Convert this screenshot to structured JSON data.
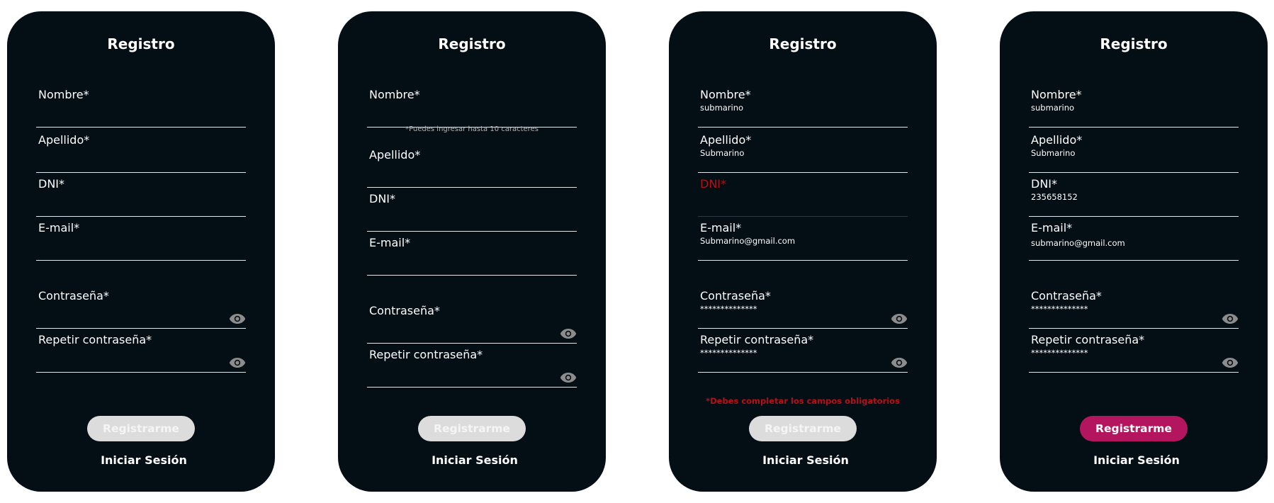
{
  "screens": [
    {
      "title": "Registro",
      "fields": {
        "nombre": {
          "label": "Nombre*",
          "value": ""
        },
        "apellido": {
          "label": "Apellido*",
          "value": ""
        },
        "dni": {
          "label": "DNI*",
          "value": ""
        },
        "email": {
          "label": "E-mail*",
          "value": ""
        },
        "password": {
          "label": "Contraseña*",
          "value": ""
        },
        "repeat_password": {
          "label": "Repetir contraseña*",
          "value": ""
        }
      },
      "submit_label": "Registrarme",
      "login_link": "Iniciar Sesión"
    },
    {
      "title": "Registro",
      "fields": {
        "nombre": {
          "label": "Nombre*",
          "value": "",
          "hint": "*Puedes ingresar hasta 10 caracteres"
        },
        "apellido": {
          "label": "Apellido*",
          "value": ""
        },
        "dni": {
          "label": "DNI*",
          "value": ""
        },
        "email": {
          "label": "E-mail*",
          "value": ""
        },
        "password": {
          "label": "Contraseña*",
          "value": ""
        },
        "repeat_password": {
          "label": "Repetir contraseña*",
          "value": ""
        }
      },
      "submit_label": "Registrarme",
      "login_link": "Iniciar Sesión"
    },
    {
      "title": "Registro",
      "fields": {
        "nombre": {
          "label": "Nombre*",
          "value": "submarino"
        },
        "apellido": {
          "label": "Apellido*",
          "value": "Submarino"
        },
        "dni": {
          "label": "DNI*",
          "value": "",
          "state": "error"
        },
        "email": {
          "label": "E-mail*",
          "value": "Submarino@gmail.com"
        },
        "password": {
          "label": "Contraseña*",
          "value": "**************"
        },
        "repeat_password": {
          "label": "Repetir contraseña*",
          "value": "**************"
        }
      },
      "error_message": "*Debes completar los campos obligatorios",
      "submit_label": "Registrarme",
      "login_link": "Iniciar Sesión"
    },
    {
      "title": "Registro",
      "fields": {
        "nombre": {
          "label": "Nombre*",
          "value": "submarino"
        },
        "apellido": {
          "label": "Apellido*",
          "value": "Submarino"
        },
        "dni": {
          "label": "DNI*",
          "value": "235658152"
        },
        "email": {
          "label": "E-mail*",
          "value": "submarino@gmail.com"
        },
        "password": {
          "label": "Contraseña*",
          "value": "**************"
        },
        "repeat_password": {
          "label": "Repetir contraseña*",
          "value": "**************"
        }
      },
      "submit_label": "Registrarme",
      "submit_state": "enabled",
      "login_link": "Iniciar Sesión"
    }
  ],
  "icons": {
    "password_toggle": "eye-icon"
  },
  "colors": {
    "card_background": "#040e15",
    "error": "#b3111a",
    "button_disabled": "#dcdcdc",
    "button_enabled": "#b3165e",
    "eye_icon": "#8c8c8c"
  }
}
